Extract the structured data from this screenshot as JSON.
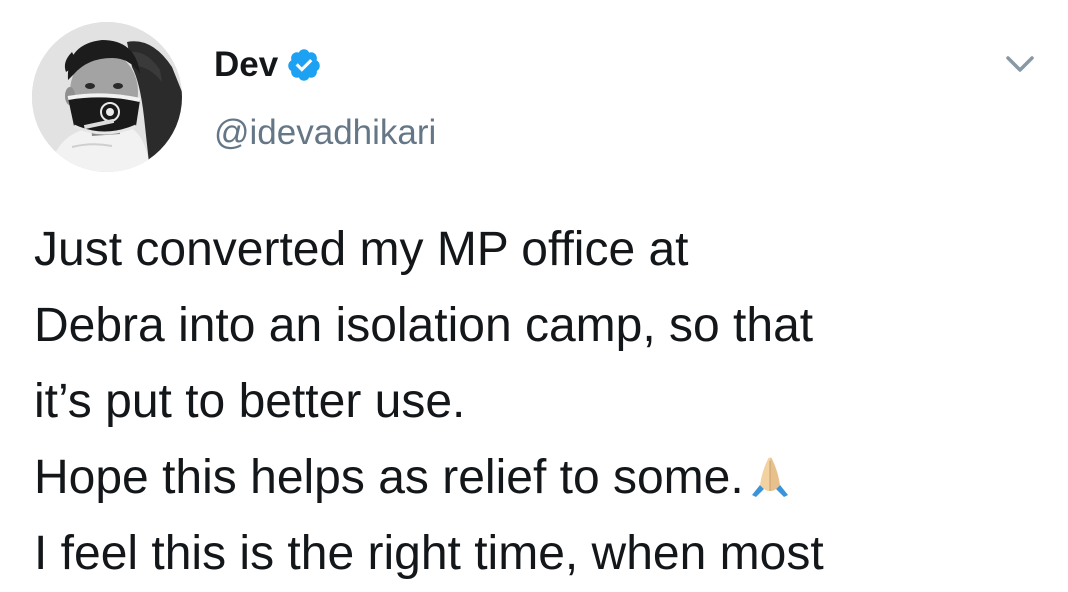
{
  "author": {
    "display_name": "Dev",
    "handle": "@idevadhikari",
    "verified": true,
    "avatar_icon": "profile-photo-masked-man"
  },
  "menu": {
    "icon": "chevron-down-icon"
  },
  "tweet": {
    "lines": [
      "Just converted my MP office at",
      "Debra into an isolation camp, so that",
      "it’s put to better use.",
      "Hope this helps as relief to some.",
      "I feel this is the right time, when most"
    ],
    "emoji": "folded-hands-emoji"
  },
  "colors": {
    "verified_badge": "#1da1f2",
    "handle_text": "#657786",
    "body_text": "#14171a",
    "chevron": "#8899a6"
  }
}
